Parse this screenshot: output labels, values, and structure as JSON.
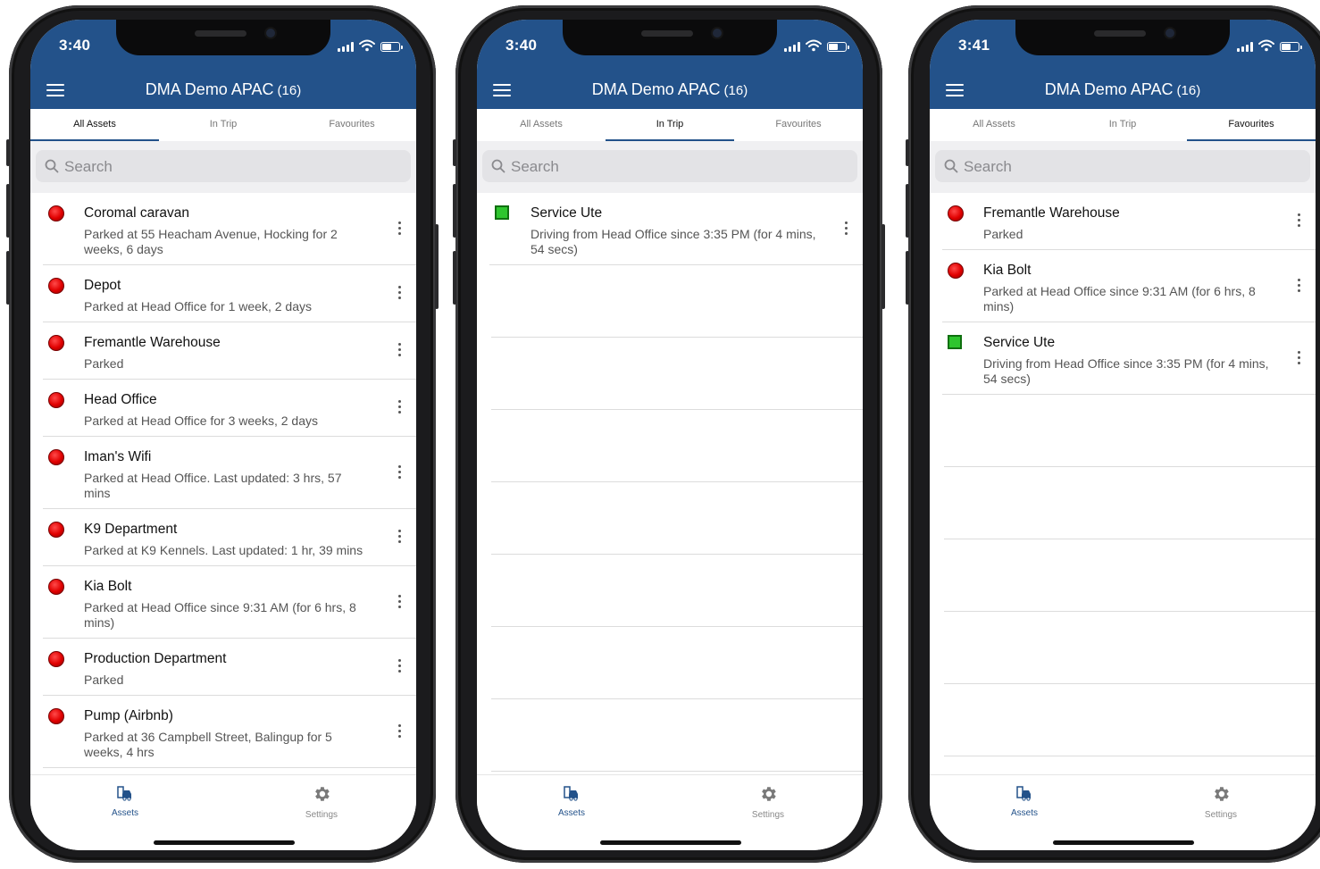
{
  "screens": [
    {
      "time": "3:40",
      "title": "DMA Demo APAC",
      "count": "(16)",
      "tabs": [
        "All Assets",
        "In Trip",
        "Favourites"
      ],
      "active_tab": 0,
      "search_placeholder": "Search",
      "items": [
        {
          "name": "Coromal caravan",
          "status": "Parked at 55 Heacham Avenue, Hocking for 2 weeks, 6 days",
          "state": "parked"
        },
        {
          "name": "Depot",
          "status": "Parked at Head Office for 1 week, 2 days",
          "state": "parked"
        },
        {
          "name": "Fremantle Warehouse",
          "status": "Parked",
          "state": "parked"
        },
        {
          "name": "Head Office",
          "status": "Parked at Head Office for 3 weeks, 2 days",
          "state": "parked"
        },
        {
          "name": "Iman's Wifi",
          "status": "Parked at Head Office. Last updated: 3 hrs, 57 mins",
          "state": "parked"
        },
        {
          "name": "K9 Department",
          "status": "Parked at K9 Kennels. Last updated: 1 hr, 39 mins",
          "state": "parked"
        },
        {
          "name": "Kia Bolt",
          "status": "Parked at Head Office since 9:31 AM (for 6 hrs, 8 mins)",
          "state": "parked"
        },
        {
          "name": "Production Department",
          "status": "Parked",
          "state": "parked"
        },
        {
          "name": "Pump (Airbnb)",
          "status": "Parked at 36 Campbell Street, Balingup for 5 weeks, 4 hrs",
          "state": "parked"
        }
      ],
      "nav": {
        "assets": "Assets",
        "settings": "Settings"
      }
    },
    {
      "time": "3:40",
      "title": "DMA Demo APAC",
      "count": "(16)",
      "tabs": [
        "All Assets",
        "In Trip",
        "Favourites"
      ],
      "active_tab": 1,
      "search_placeholder": "Search",
      "items": [
        {
          "name": "Service Ute",
          "status": "Driving from Head Office since 3:35 PM (for 4 mins, 54 secs)",
          "state": "driving"
        }
      ],
      "nav": {
        "assets": "Assets",
        "settings": "Settings"
      }
    },
    {
      "time": "3:41",
      "title": "DMA Demo APAC",
      "count": "(16)",
      "tabs": [
        "All Assets",
        "In Trip",
        "Favourites"
      ],
      "active_tab": 2,
      "search_placeholder": "Search",
      "items": [
        {
          "name": "Fremantle Warehouse",
          "status": "Parked",
          "state": "parked"
        },
        {
          "name": "Kia Bolt",
          "status": "Parked at Head Office since 9:31 AM (for 6 hrs, 8 mins)",
          "state": "parked"
        },
        {
          "name": "Service Ute",
          "status": "Driving from Head Office since 3:35 PM (for 4 mins, 54 secs)",
          "state": "driving"
        }
      ],
      "nav": {
        "assets": "Assets",
        "settings": "Settings"
      }
    }
  ],
  "icons": {
    "menu": "hamburger-icon",
    "search": "search-icon",
    "more": "kebab-icon",
    "parked": "red-dot-icon",
    "driving": "green-square-icon",
    "assets": "assets-car-icon",
    "settings": "gear-icon"
  },
  "colors": {
    "header": "#23528a",
    "parked": "#e00000",
    "driving": "#2ec52e"
  }
}
